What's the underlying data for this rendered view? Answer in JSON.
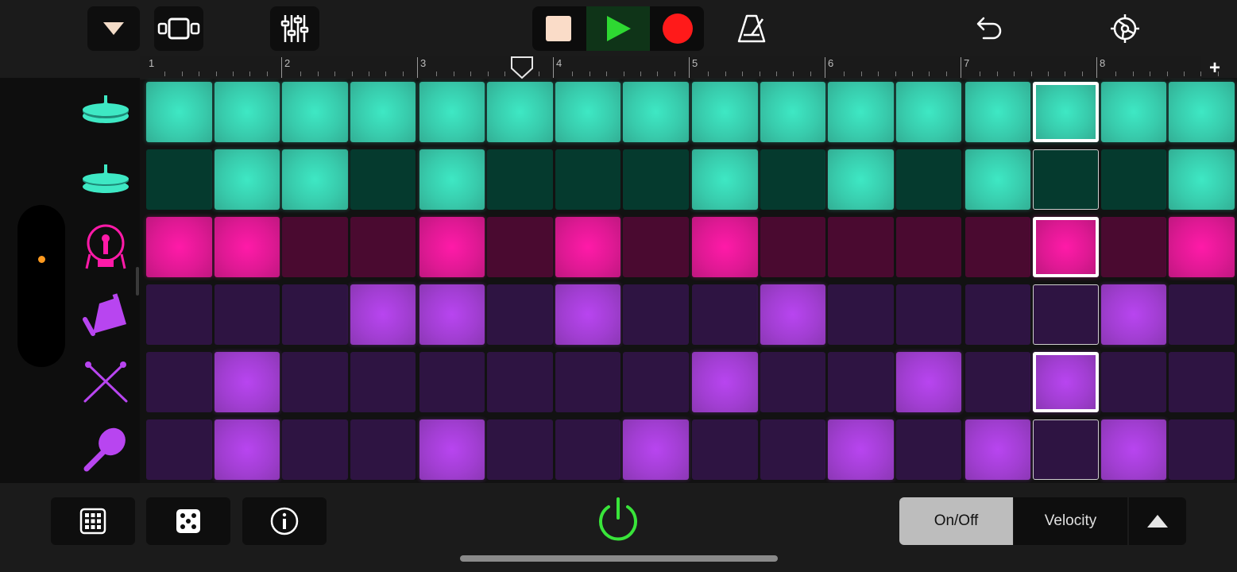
{
  "ruler": {
    "bars": [
      "1",
      "2",
      "3",
      "4",
      "5",
      "6",
      "7",
      "8"
    ]
  },
  "instruments": [
    {
      "name": "crash-cymbal",
      "icon": "cymbal-icon",
      "color": "#3ee8c4"
    },
    {
      "name": "hi-hat",
      "icon": "hihat-icon",
      "color": "#3ee8c4"
    },
    {
      "name": "kick-drum",
      "icon": "kick-drum-icon",
      "color": "#ff1aa8"
    },
    {
      "name": "cowbell",
      "icon": "cowbell-icon",
      "color": "#b845f0"
    },
    {
      "name": "sticks",
      "icon": "drumsticks-icon",
      "color": "#b845f0"
    },
    {
      "name": "maraca",
      "icon": "maraca-icon",
      "color": "#b845f0"
    }
  ],
  "pattern": [
    [
      1,
      1,
      1,
      1,
      1,
      1,
      1,
      1,
      1,
      1,
      1,
      1,
      1,
      1,
      1,
      1
    ],
    [
      0,
      1,
      1,
      0,
      1,
      0,
      0,
      0,
      1,
      0,
      1,
      0,
      1,
      0,
      0,
      1
    ],
    [
      1,
      1,
      0,
      0,
      1,
      0,
      1,
      0,
      1,
      0,
      0,
      0,
      0,
      1,
      0,
      1
    ],
    [
      0,
      0,
      0,
      1,
      1,
      0,
      1,
      0,
      0,
      1,
      0,
      0,
      0,
      0,
      1,
      0
    ],
    [
      0,
      1,
      0,
      0,
      0,
      0,
      0,
      0,
      1,
      0,
      0,
      1,
      0,
      1,
      0,
      0
    ],
    [
      0,
      1,
      0,
      0,
      1,
      0,
      0,
      1,
      0,
      0,
      1,
      0,
      1,
      0,
      1,
      0
    ]
  ],
  "playhead_step": 13,
  "playhead_position_beats": 2.75,
  "colors": {
    "teal_on": "#3ee8c4",
    "teal_off": "#053a2e",
    "pink_on": "#ff1aa8",
    "pink_off": "#4a0a30",
    "purple_on": "#b845f0",
    "purple_off": "#2e1442",
    "play_green": "#2ed832",
    "record_red": "#ff1a1a",
    "power_green": "#39e43a"
  },
  "bottom": {
    "mode_onoff": "On/Off",
    "mode_velocity": "Velocity"
  }
}
